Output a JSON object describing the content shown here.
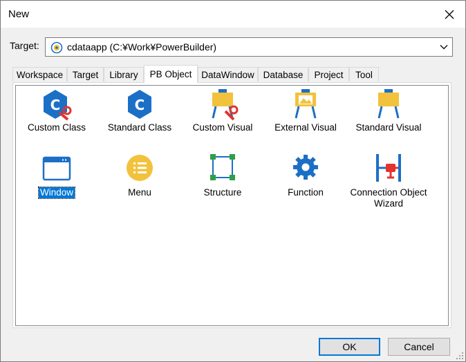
{
  "dialog": {
    "title": "New",
    "close_icon": "close-icon"
  },
  "target": {
    "label": "Target:",
    "value": "cdataapp (C:¥Work¥PowerBuilder)"
  },
  "tabs": [
    {
      "label": "Workspace"
    },
    {
      "label": "Target"
    },
    {
      "label": "Library"
    },
    {
      "label": "PB Object",
      "active": true
    },
    {
      "label": "DataWindow"
    },
    {
      "label": "Database"
    },
    {
      "label": "Project"
    },
    {
      "label": "Tool"
    }
  ],
  "items": [
    {
      "label": "Custom Class",
      "icon": "custom-class-icon"
    },
    {
      "label": "Standard Class",
      "icon": "standard-class-icon"
    },
    {
      "label": "Custom Visual",
      "icon": "custom-visual-icon"
    },
    {
      "label": "External Visual",
      "icon": "external-visual-icon"
    },
    {
      "label": "Standard Visual",
      "icon": "standard-visual-icon"
    },
    {
      "label": "Window",
      "icon": "window-icon",
      "selected": true
    },
    {
      "label": "Menu",
      "icon": "menu-icon"
    },
    {
      "label": "Structure",
      "icon": "structure-icon"
    },
    {
      "label": "Function",
      "icon": "function-icon"
    },
    {
      "label": "Connection Object Wizard",
      "icon": "connection-wizard-icon"
    }
  ],
  "buttons": {
    "ok": "OK",
    "cancel": "Cancel"
  },
  "colors": {
    "accent": "#0078d7",
    "brand_blue": "#1c6fc6",
    "yellow": "#f2c23c",
    "red": "#e2342c",
    "green": "#2ea043"
  }
}
